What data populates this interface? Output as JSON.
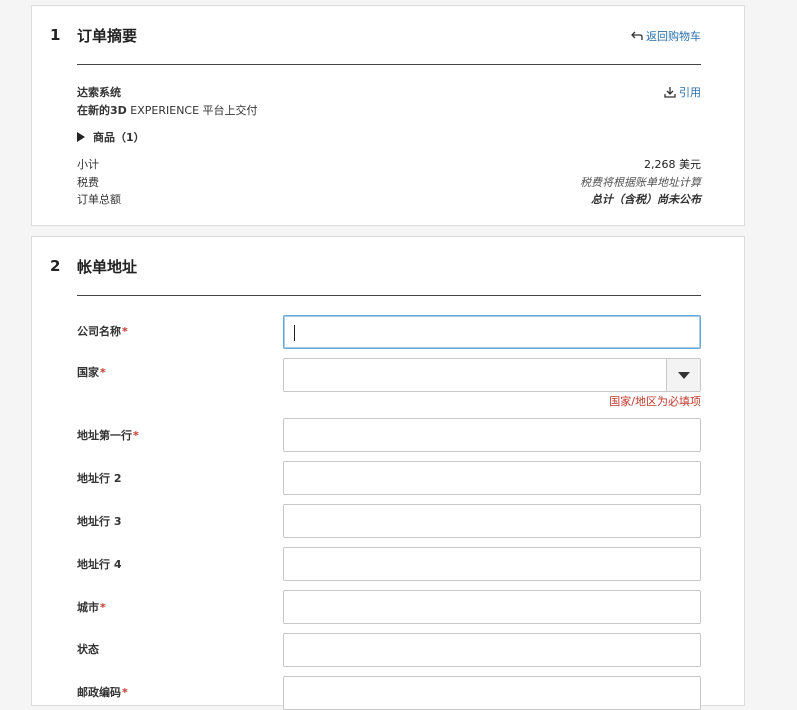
{
  "summary": {
    "step_number": "1",
    "title": "订单摘要",
    "back_link": "返回购物车",
    "vendor": "达索系统",
    "delivery_prefix": "在新的3D",
    "delivery_suffix": " EXPERIENCE 平台上交付",
    "quote_link": "引用",
    "items_toggle": "商品（1）",
    "subtotal_label": "小计",
    "subtotal_value": "2,268 美元",
    "tax_label": "税费",
    "tax_value": "税费将根据账单地址计算",
    "total_label": "订单总额",
    "total_value": "总计（含税）尚未公布"
  },
  "billing": {
    "step_number": "2",
    "title": "帐单地址",
    "required_mark": "*",
    "fields": {
      "company": {
        "label": "公司名称",
        "value": ""
      },
      "country": {
        "label": "国家",
        "value": "",
        "error": "国家/地区为必填项"
      },
      "address1": {
        "label": "地址第一行",
        "value": ""
      },
      "address2": {
        "label": "地址行 2",
        "value": ""
      },
      "address3": {
        "label": "地址行 3",
        "value": ""
      },
      "address4": {
        "label": "地址行 4",
        "value": ""
      },
      "city": {
        "label": "城市",
        "value": ""
      },
      "state": {
        "label": "状态",
        "value": ""
      },
      "postal": {
        "label": "邮政编码",
        "value": ""
      }
    }
  },
  "icons": {
    "back": "return-arrow-icon",
    "quote": "download-icon",
    "toggle": "triangle-right-icon",
    "select": "chevron-down-icon"
  },
  "colors": {
    "link": "#2a6fa8",
    "required": "#c0392b",
    "focus_border": "#6aa6d6"
  }
}
